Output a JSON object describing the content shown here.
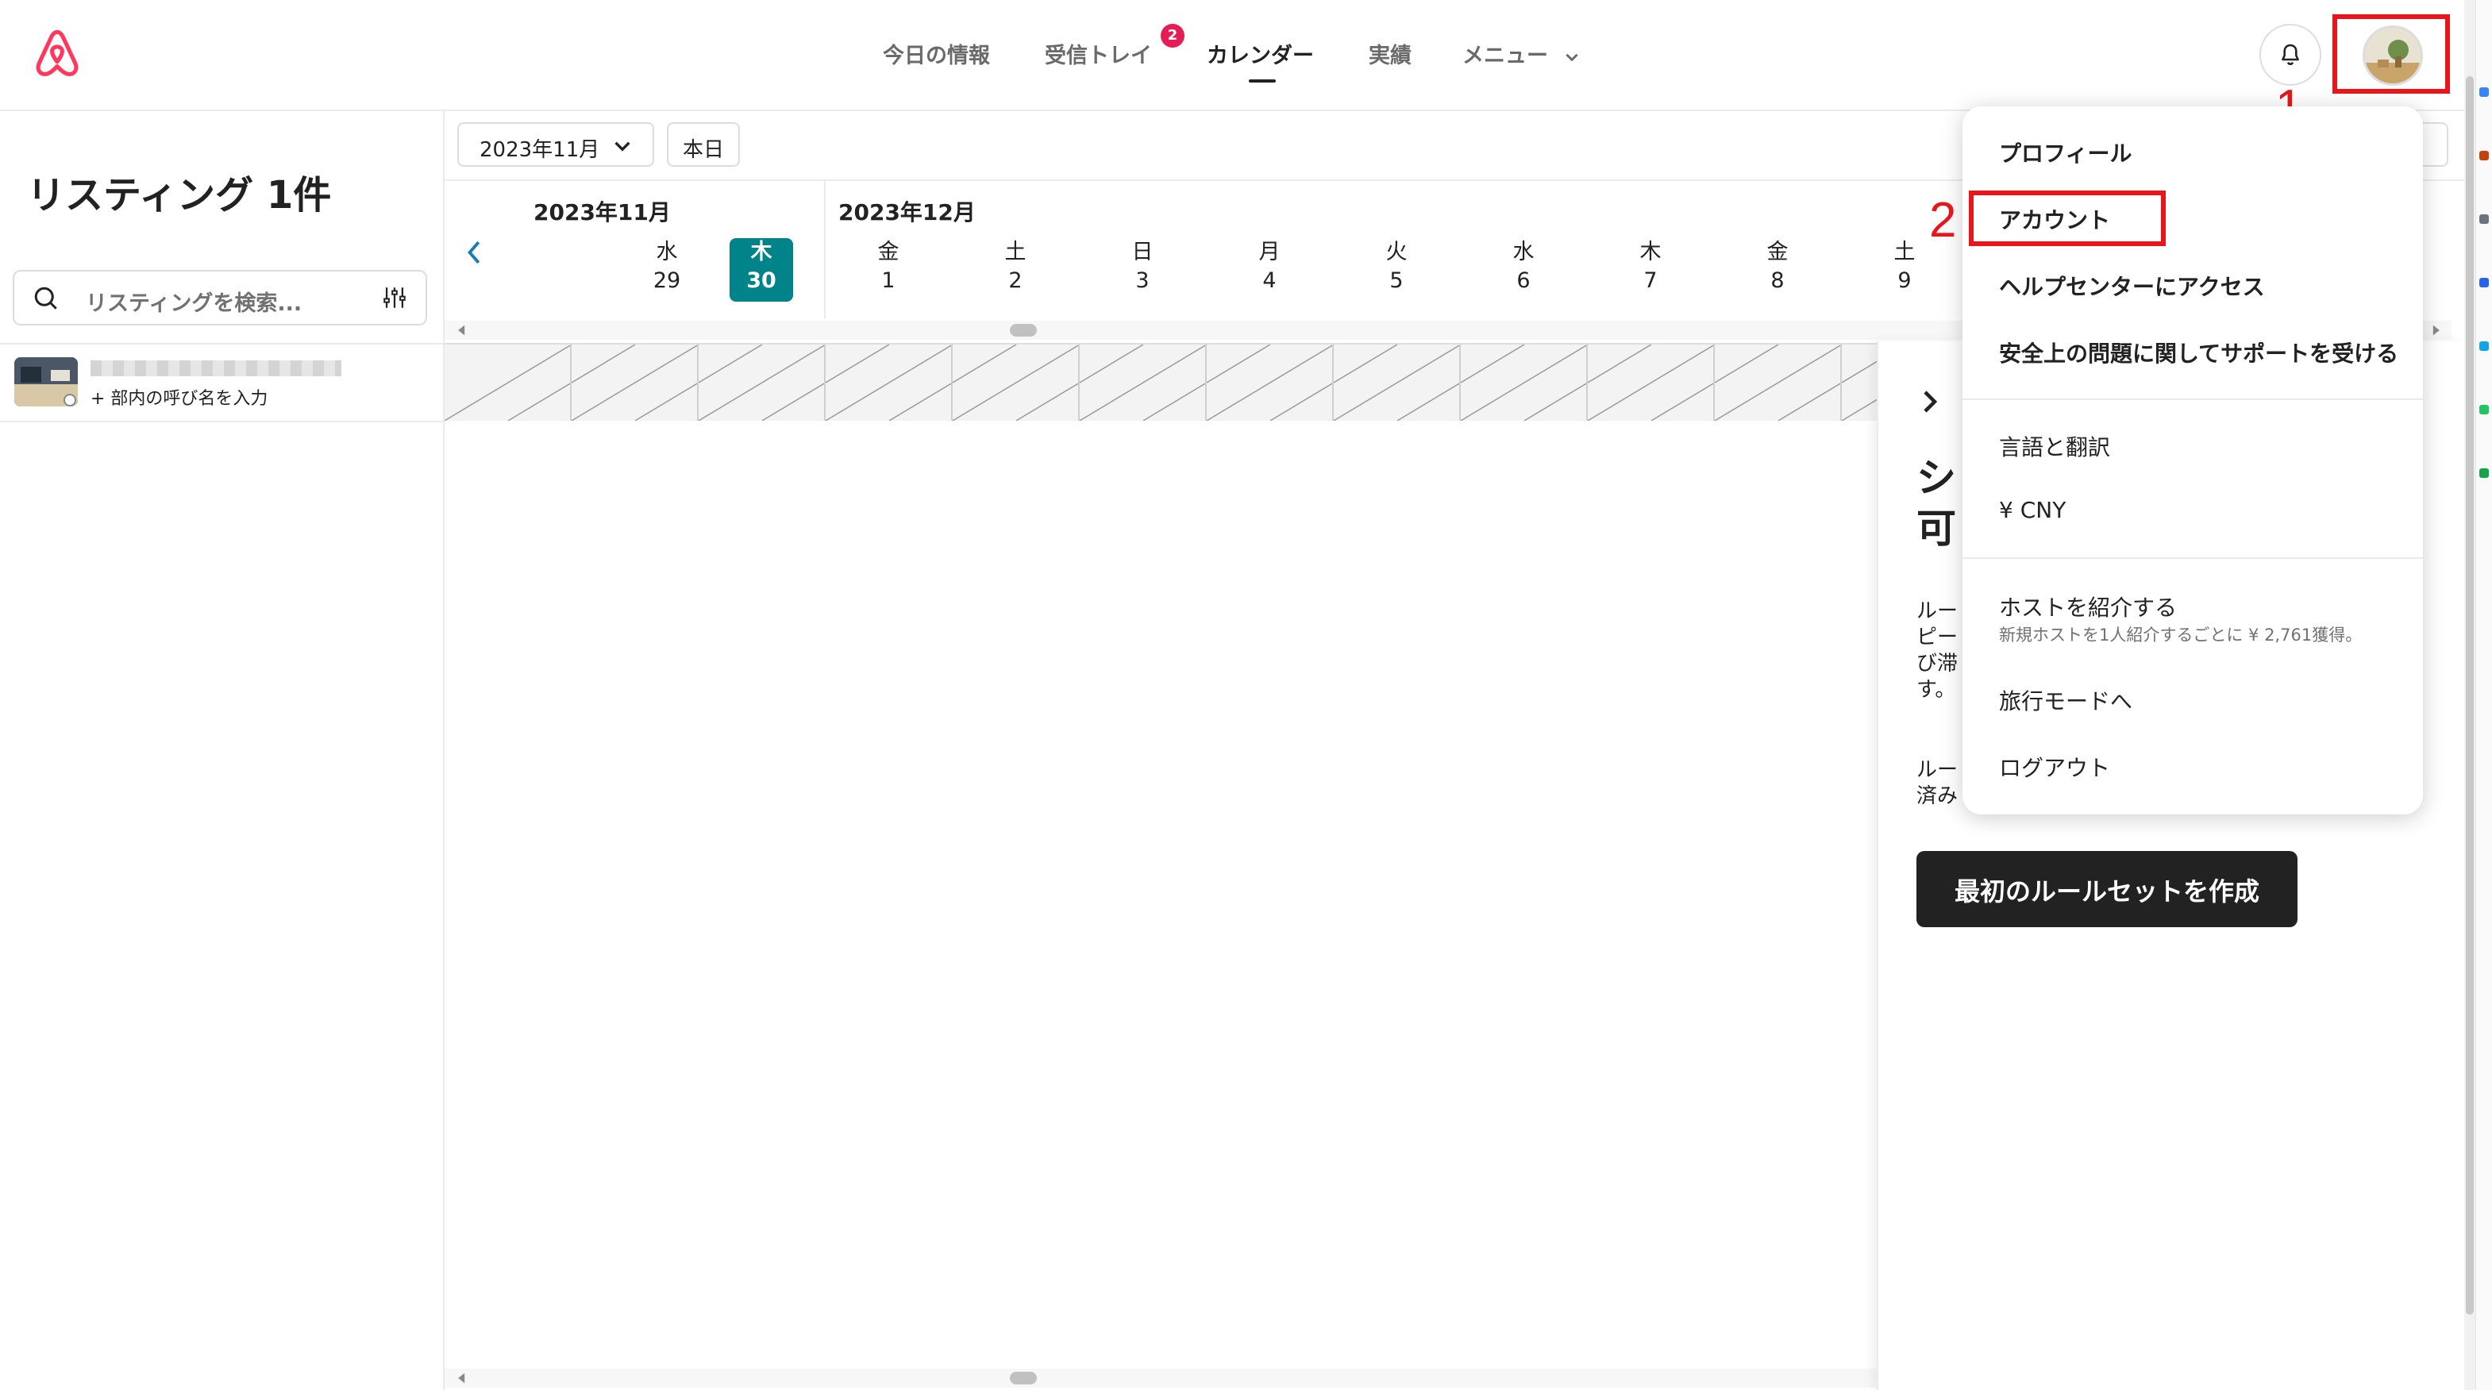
{
  "header": {
    "nav": {
      "today": "今日の情報",
      "inbox": "受信トレイ",
      "inbox_badge": "2",
      "calendar": "カレンダー",
      "performance": "実績",
      "menu": "メニュー"
    }
  },
  "annotations": {
    "step1": "1",
    "step2": "2"
  },
  "sidebar": {
    "title": "リスティング 1件",
    "search_placeholder": "リスティングを検索...",
    "listing": {
      "nickname_prompt": "+ 部内の呼び名を入力"
    }
  },
  "calendar": {
    "month_select": "2023年11月",
    "today_button": "本日",
    "months": [
      "2023年11月",
      "2023年12月"
    ],
    "days": [
      {
        "dow": "水",
        "num": "29"
      },
      {
        "dow": "木",
        "num": "30"
      },
      {
        "dow": "金",
        "num": "1"
      },
      {
        "dow": "土",
        "num": "2"
      },
      {
        "dow": "日",
        "num": "3"
      },
      {
        "dow": "月",
        "num": "4"
      },
      {
        "dow": "火",
        "num": "5"
      },
      {
        "dow": "水",
        "num": "6"
      },
      {
        "dow": "木",
        "num": "7"
      },
      {
        "dow": "金",
        "num": "8"
      },
      {
        "dow": "土",
        "num": "9"
      }
    ]
  },
  "panel": {
    "title": "シ 可",
    "desc1": "ルー ピー び滞 す。",
    "desc2": "ルー 済み",
    "create_button": "最初のルールセットを作成"
  },
  "dropdown": {
    "profile": "プロフィール",
    "account": "アカウント",
    "help_center": "ヘルプセンターにアクセス",
    "safety": "安全上の問題に関してサポートを受ける",
    "language": "言語と翻訳",
    "currency": "¥ CNY",
    "refer_host": "ホストを紹介する",
    "refer_host_sub": "新規ホストを1人紹介するごとに ¥ 2,761獲得。",
    "travel_mode": "旅行モードへ",
    "logout": "ログアウト"
  },
  "colors": {
    "brand": "#ff385c",
    "today_cell": "#008489",
    "annotation_red": "#e8161b",
    "badge": "#e41d57"
  }
}
